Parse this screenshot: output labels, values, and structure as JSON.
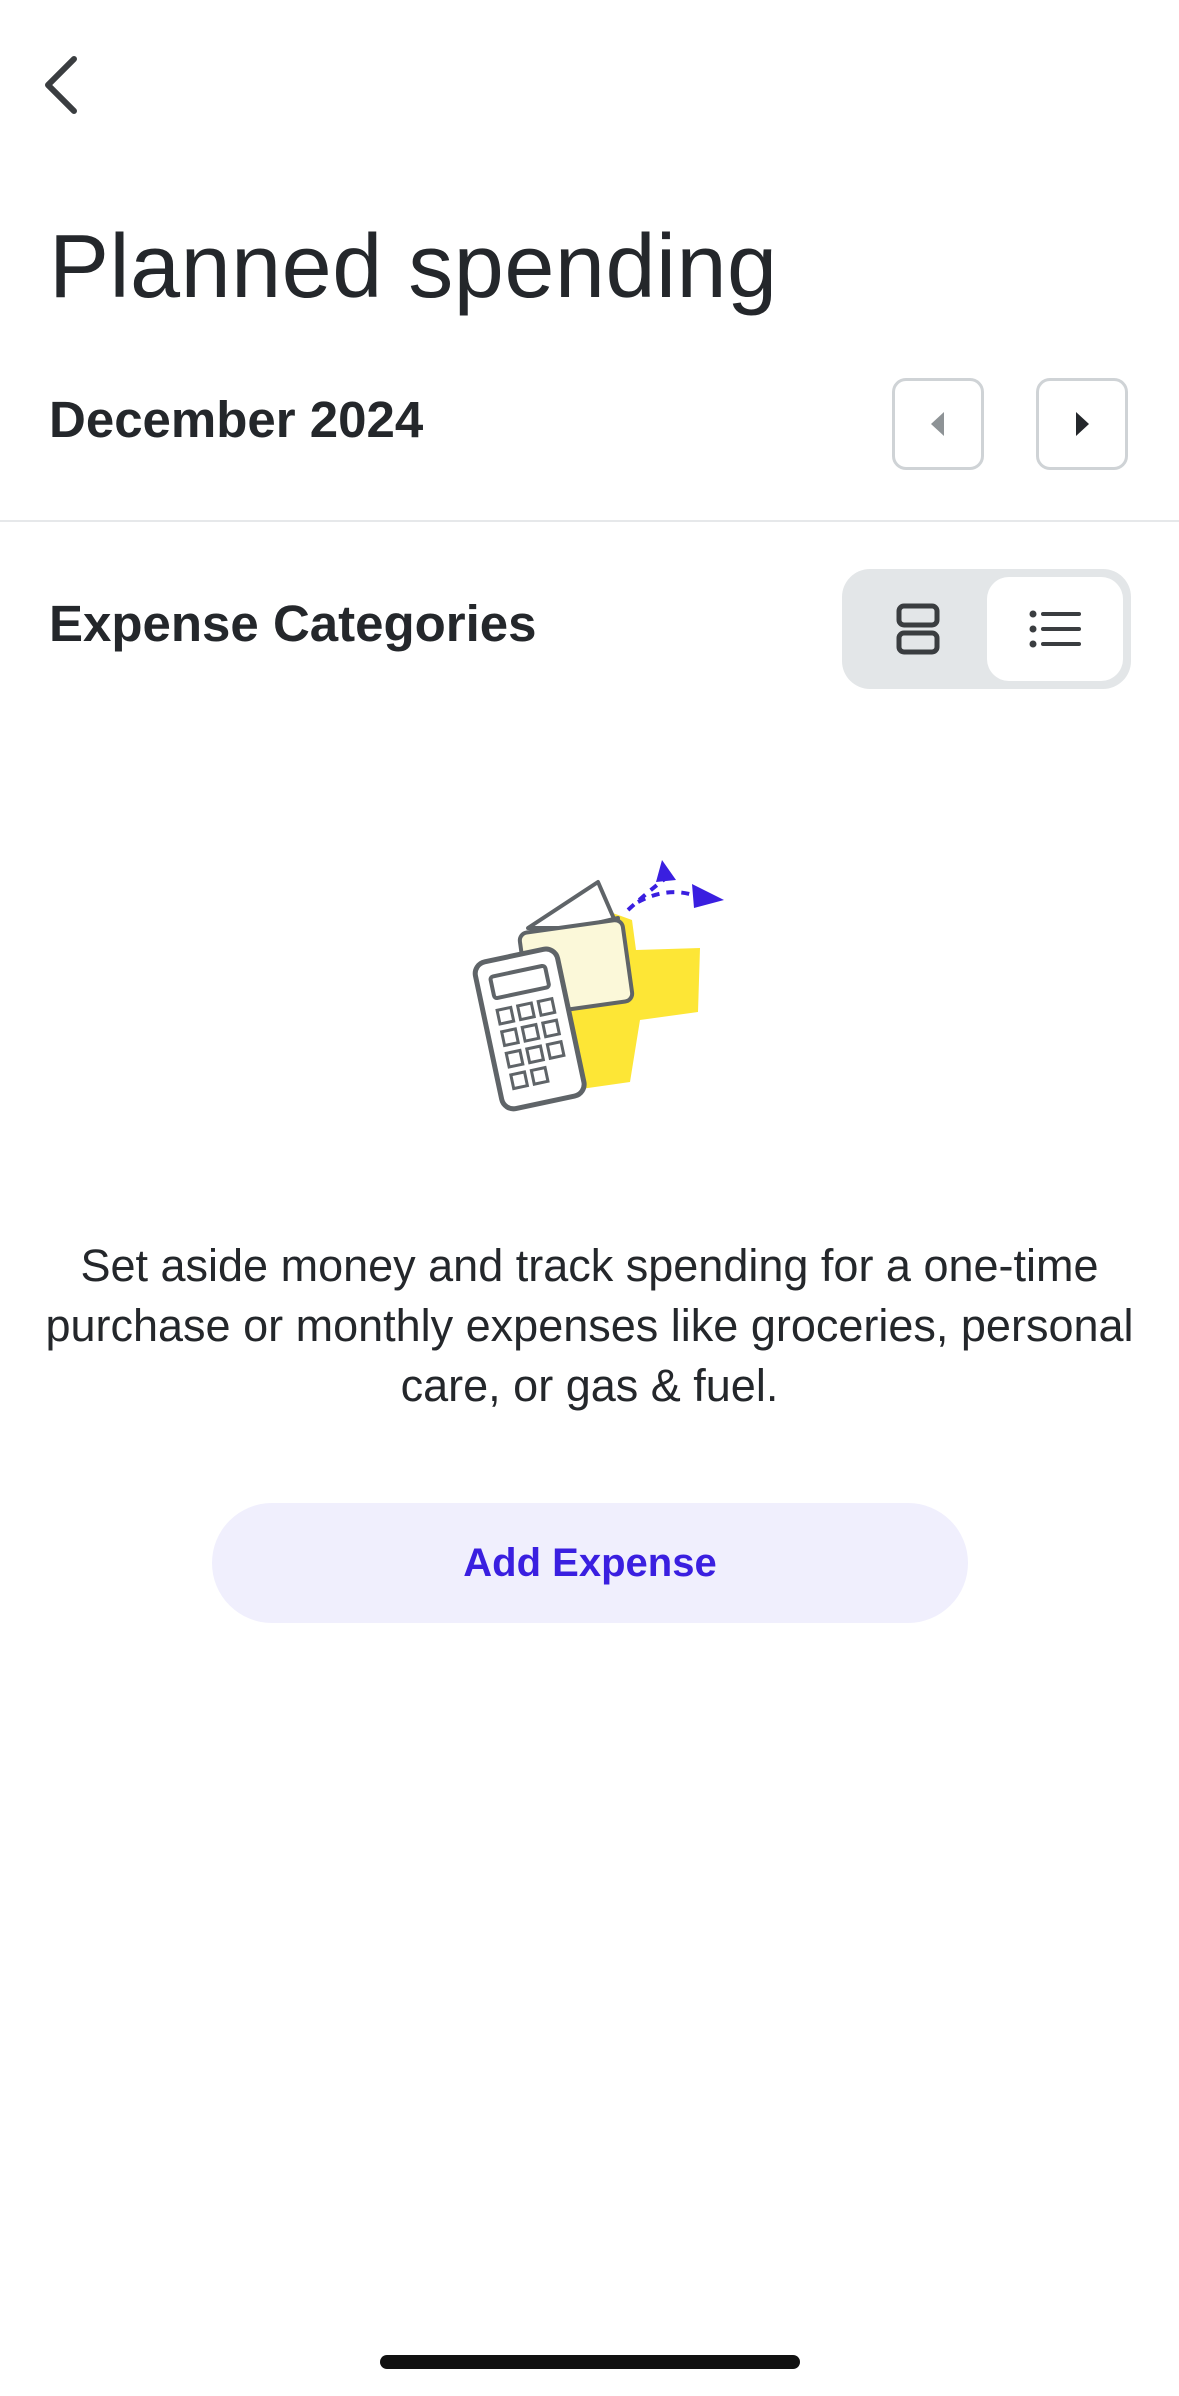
{
  "header": {
    "back_icon": "chevron-left-icon",
    "title": "Planned spending"
  },
  "period": {
    "month": "December 2024",
    "prev_icon": "caret-left-icon",
    "next_icon": "caret-right-icon"
  },
  "section": {
    "title": "Expense Categories",
    "view_toggle": {
      "options": [
        {
          "icon": "card-view-icon",
          "selected": false
        },
        {
          "icon": "list-view-icon",
          "selected": true
        }
      ]
    }
  },
  "empty_state": {
    "illustration": "calculator-wallet-illustration",
    "message": "Set aside money and track spending for a one-time purchase or monthly expenses like groceries, personal care, or gas & fuel.",
    "button_label": "Add Expense"
  },
  "colors": {
    "accent": "#3a1fe0",
    "button_bg": "#f0effd",
    "illustration_yellow": "#fde636",
    "text": "#24272b"
  }
}
